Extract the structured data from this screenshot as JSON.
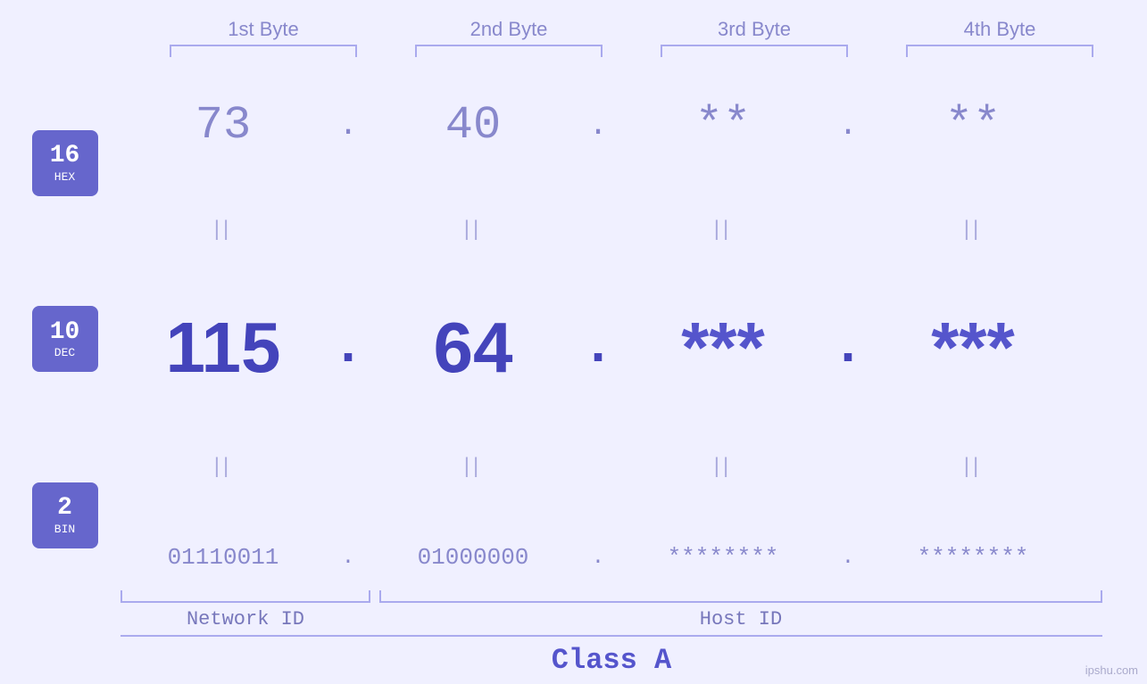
{
  "header": {
    "byte1_label": "1st Byte",
    "byte2_label": "2nd Byte",
    "byte3_label": "3rd Byte",
    "byte4_label": "4th Byte"
  },
  "badges": {
    "hex": {
      "number": "16",
      "label": "HEX"
    },
    "dec": {
      "number": "10",
      "label": "DEC"
    },
    "bin": {
      "number": "2",
      "label": "BIN"
    }
  },
  "rows": {
    "hex": {
      "b1": "73",
      "b2": "40",
      "b3": "**",
      "b4": "**",
      "dot": "."
    },
    "dec": {
      "b1": "115",
      "b2": "64",
      "b3": "***",
      "b4": "***",
      "dot": "."
    },
    "bin": {
      "b1": "01110011",
      "b2": "01000000",
      "b3": "********",
      "b4": "********",
      "dot": "."
    }
  },
  "bottom": {
    "network_id": "Network ID",
    "host_id": "Host ID",
    "class_label": "Class A"
  },
  "footer": {
    "site": "ipshu.com"
  }
}
